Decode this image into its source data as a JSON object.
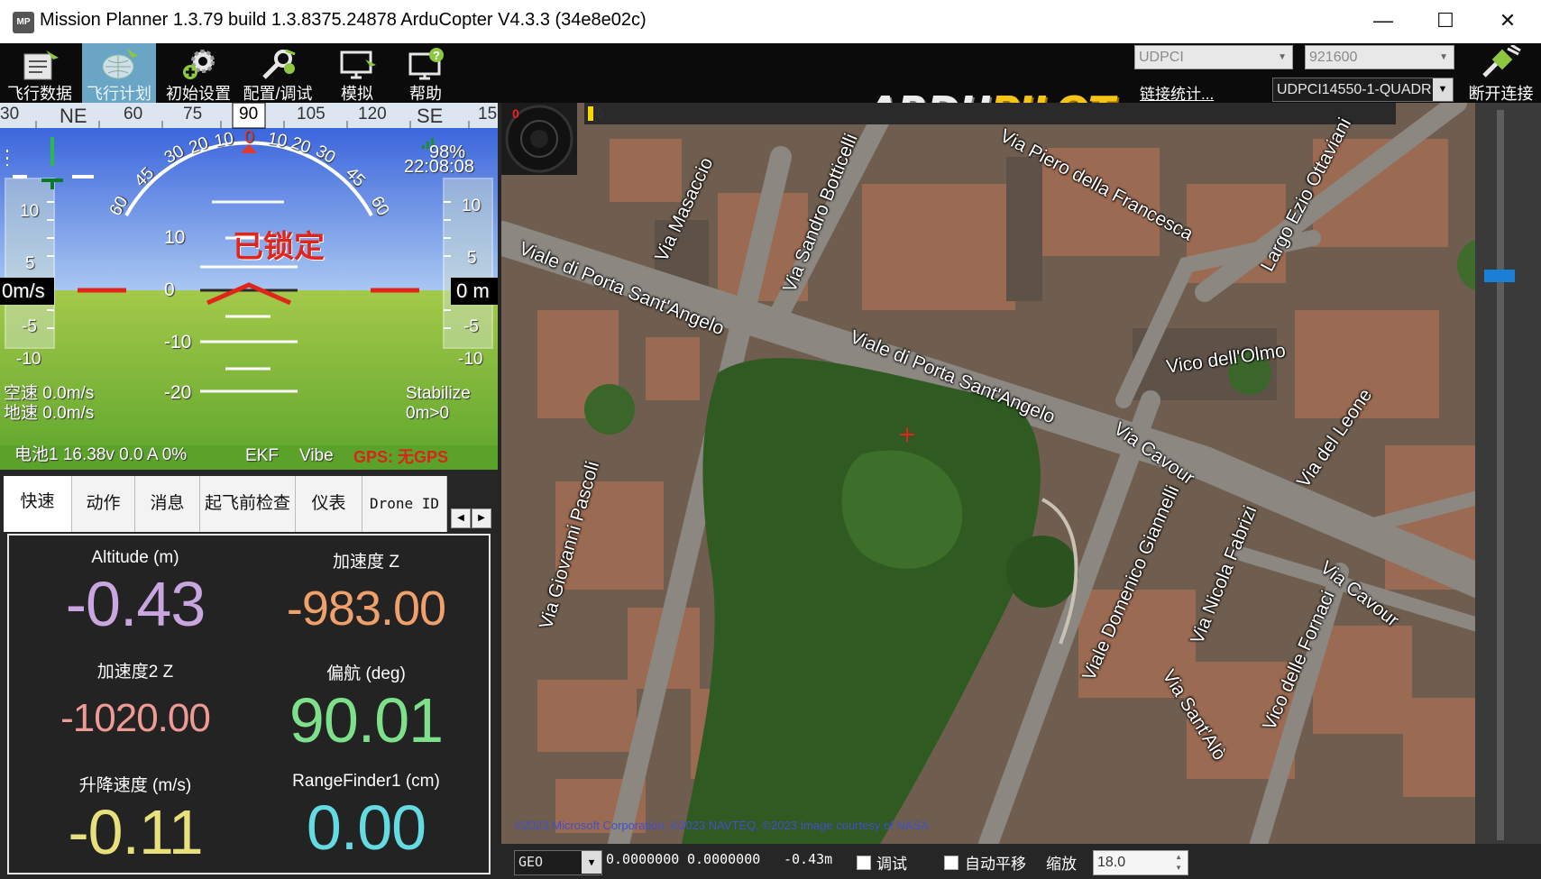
{
  "window": {
    "title": "Mission Planner 1.3.79 build 1.3.8375.24878 ArduCopter V4.3.3 (34e8e02c)",
    "logo_text": "MP",
    "minimize": "—",
    "maximize": "☐",
    "close": "✕"
  },
  "toolbar": {
    "items": [
      {
        "label": "飞行数据",
        "icon": "flight-data-icon"
      },
      {
        "label": "飞行计划",
        "icon": "flight-plan-icon",
        "active": true
      },
      {
        "label": "初始设置",
        "icon": "initial-setup-icon"
      },
      {
        "label": "配置/调试",
        "icon": "config-tuning-icon"
      },
      {
        "label": "模拟",
        "icon": "simulation-icon"
      },
      {
        "label": "帮助",
        "icon": "help-icon"
      }
    ],
    "brand_left": "ARDU",
    "brand_right": "PILOT",
    "port_select": "UDPCI",
    "baud_select": "921600",
    "stats_link": "链接统计...",
    "device_select": "UDPCI14550-1-QUADR",
    "disconnect_label": "断开连接"
  },
  "hud": {
    "heading_ticks": [
      "30",
      "NE",
      "60",
      "75",
      "90",
      "105",
      "120",
      "SE",
      "15"
    ],
    "heading_value": "90",
    "bank_labels": [
      "60",
      "45",
      "30",
      "20",
      "10",
      "0",
      "10",
      "20",
      "30",
      "45",
      "60"
    ],
    "battery_remaining": "98%",
    "time": "22:08:08",
    "speed_scale": [
      "10",
      "5",
      "0",
      "-5",
      "-10"
    ],
    "speed_value": "0m/s",
    "alt_scale": [
      "10",
      "5",
      "0",
      "-5",
      "-10"
    ],
    "alt_value": "0 m",
    "pitch_labels": [
      "10",
      "0",
      "-10",
      "-20"
    ],
    "armed_status": "已锁定",
    "airspeed": "空速 0.0m/s",
    "groundspeed": "地速 0.0m/s",
    "mode": "Stabilize",
    "wp_info": "0m>0",
    "battery": "电池1 16.38v 0.0 A 0%",
    "ekf": "EKF",
    "vibe": "Vibe",
    "gps": "GPS: 无GPS"
  },
  "tabs": [
    {
      "label": "快速",
      "active": true
    },
    {
      "label": "动作"
    },
    {
      "label": "消息"
    },
    {
      "label": "起飞前检查"
    },
    {
      "label": "仪表"
    },
    {
      "label": "Drone ID"
    }
  ],
  "tab_scroll": {
    "left": "◀",
    "right": "▶"
  },
  "quick": [
    {
      "label": "Altitude (m)",
      "value": "-0.43",
      "color": "#c9a6e0"
    },
    {
      "label": "加速度 Z",
      "value": "-983.00",
      "color": "#f0a06a"
    },
    {
      "label": "加速度2 Z",
      "value": "-1020.00",
      "color": "#f09a96"
    },
    {
      "label": "偏航 (deg)",
      "value": "90.01",
      "color": "#7fe08c"
    },
    {
      "label": "升降速度 (m/s)",
      "value": "-0.11",
      "color": "#e8e07c"
    },
    {
      "label": "RangeFinder1 (cm)",
      "value": "0.00",
      "color": "#64dae2"
    }
  ],
  "map": {
    "streets": [
      {
        "name": "Via Masaccio"
      },
      {
        "name": "Via Sandro Botticelli"
      },
      {
        "name": "Via Piero della Francesca"
      },
      {
        "name": "Largo Ezio Ottaviani"
      },
      {
        "name": "Viale di Porta Sant'Angelo"
      },
      {
        "name": "Viale di Porta Sant'Angelo"
      },
      {
        "name": "Vico dell'Olmo"
      },
      {
        "name": "Via Cavour"
      },
      {
        "name": "Via del Leone"
      },
      {
        "name": "Via Giovanni Pascoli"
      },
      {
        "name": "Viale Domenico Giannelli"
      },
      {
        "name": "Via Nicola Fabrizi"
      },
      {
        "name": "Via Cavour"
      },
      {
        "name": "Vico delle Fornaci"
      },
      {
        "name": "Via Sant'Alò"
      }
    ],
    "rc_indicator": "0",
    "progress_label": "0",
    "copyright": "©2023 Microsoft Corporation, ©2023 NAVTEQ, ©2023 Image courtesy of NASA",
    "coord_type": "GEO",
    "lat": "0.0000000",
    "lng": "0.0000000",
    "alt": "-0.43m",
    "debug_label": "调试",
    "autopan_label": "自动平移",
    "zoom_label": "缩放",
    "zoom_value": "18.0"
  }
}
